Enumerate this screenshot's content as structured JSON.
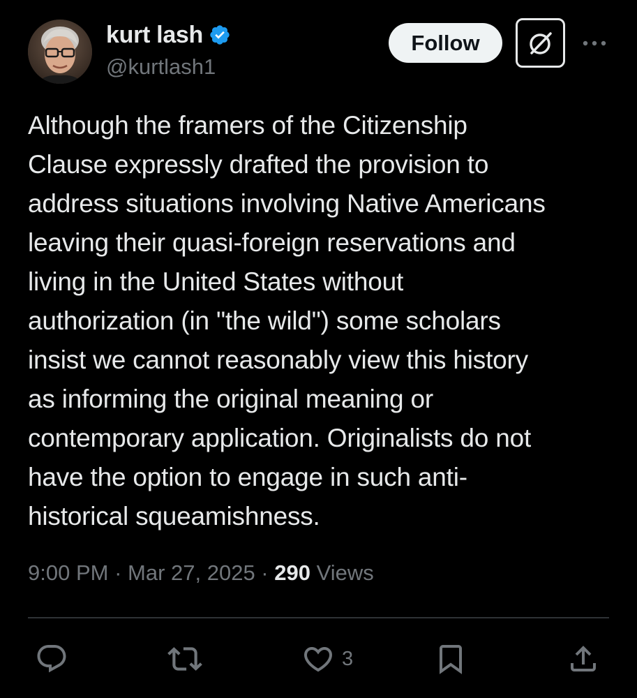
{
  "author": {
    "display_name": "kurt lash",
    "handle": "@kurtlash1",
    "verified": true,
    "verified_color": "#1d9bf0"
  },
  "header": {
    "follow_label": "Follow",
    "grok_icon": "grok-icon",
    "more_icon": "more-icon"
  },
  "tweet": {
    "text": "Although the framers of the Citizenship\nClause expressly drafted the provision to\naddress situations involving Native Americans\nleaving their quasi-foreign reservations and\nliving in the United States without\nauthorization (in \"the wild\") some scholars\ninsist we cannot reasonably view this history\nas informing the original meaning or\ncontemporary application. Originalists do not\nhave the option to engage in such anti-\nhistorical squeamishness."
  },
  "meta": {
    "time": "9:00 PM",
    "separator": " · ",
    "date": "Mar 27, 2025",
    "views_count": "290",
    "views_label": " Views"
  },
  "actions": {
    "reply_icon": "reply-icon",
    "retweet_icon": "retweet-icon",
    "like_icon": "heart-icon",
    "like_count": "3",
    "bookmark_icon": "bookmark-icon",
    "share_icon": "share-icon"
  },
  "colors": {
    "background": "#000000",
    "primary_text": "#e7e9ea",
    "secondary_text": "#71767b",
    "divider": "#2f3336",
    "follow_button_bg": "#eff3f4"
  }
}
